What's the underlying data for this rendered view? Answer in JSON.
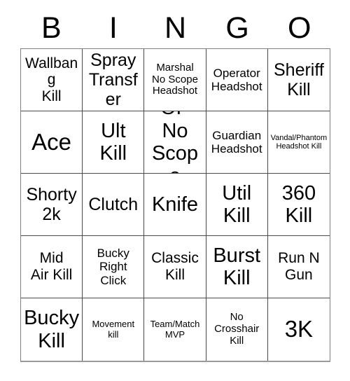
{
  "card": {
    "headers": [
      "B",
      "I",
      "N",
      "G",
      "O"
    ],
    "cells": [
      {
        "text": "Wallbang\nKill",
        "size": "fs-md"
      },
      {
        "text": "Spray\nTransfer",
        "size": "fs-lg"
      },
      {
        "text": "Marshal\nNo Scope\nHeadshot",
        "size": "fs-xs"
      },
      {
        "text": "Operator\nHeadshot",
        "size": "fs-sm"
      },
      {
        "text": "Sheriff\nKill",
        "size": "fs-lg"
      },
      {
        "text": "Ace",
        "size": "fs-xxl"
      },
      {
        "text": "Ult\nKill",
        "size": "fs-xl"
      },
      {
        "text": "OP No\nScope",
        "size": "fs-xl"
      },
      {
        "text": "Guardian\nHeadshot",
        "size": "fs-sm"
      },
      {
        "text": "Vandal/Phantom\nHeadshot Kill",
        "size": "fs-tiny"
      },
      {
        "text": "Shorty\n2k",
        "size": "fs-lg"
      },
      {
        "text": "Clutch",
        "size": "fs-lg"
      },
      {
        "text": "Knife",
        "size": "fs-xl"
      },
      {
        "text": "Util\nKill",
        "size": "fs-xl"
      },
      {
        "text": "360\nKill",
        "size": "fs-xl"
      },
      {
        "text": "Mid\nAir Kill",
        "size": "fs-md"
      },
      {
        "text": "Bucky\nRight\nClick",
        "size": "fs-sm"
      },
      {
        "text": "Classic\nKill",
        "size": "fs-md"
      },
      {
        "text": "Burst\nKill",
        "size": "fs-xl"
      },
      {
        "text": "Run N\nGun",
        "size": "fs-md"
      },
      {
        "text": "Bucky\nKill",
        "size": "fs-xl"
      },
      {
        "text": "Movement\nkill",
        "size": "fs-xxs"
      },
      {
        "text": "Team/Match\nMVP",
        "size": "fs-xxs"
      },
      {
        "text": "No\nCrosshair\nKill",
        "size": "fs-xs"
      },
      {
        "text": "3K",
        "size": "fs-xxl"
      }
    ]
  }
}
